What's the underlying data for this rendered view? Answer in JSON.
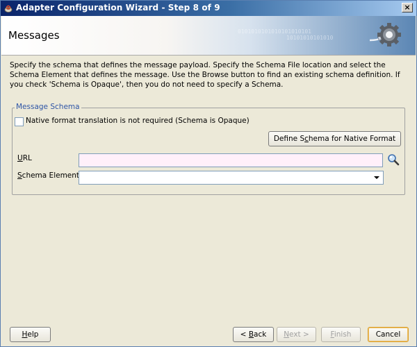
{
  "window": {
    "title": "Adapter Configuration Wizard - Step 8 of 9",
    "close_label": "×"
  },
  "header": {
    "title": "Messages",
    "digits_line1": "0101010101010101010101",
    "digits_line2": "10101010101010",
    "icon": "gear-plug-icon"
  },
  "description": "Specify the schema that defines the message payload.  Specify the Schema File location and select the Schema Element that defines the message. Use the Browse button to find an existing schema definition. If you check 'Schema is Opaque', then you do not need to specify a Schema.",
  "message_schema": {
    "legend": "Message Schema",
    "opaque_checkbox": {
      "label": "Native format translation is not required (Schema is Opaque)",
      "checked": false
    },
    "define_button": {
      "pre": "Define S",
      "mnemonic": "c",
      "post": "hema for Native Format"
    },
    "url": {
      "label_mnemonic": "U",
      "label_rest": "RL",
      "value": ""
    },
    "schema_element": {
      "label_mnemonic": "S",
      "label_rest": "chema Element",
      "value": ""
    }
  },
  "footer": {
    "help": {
      "mnemonic": "H",
      "rest": "elp"
    },
    "back": {
      "pre": "< ",
      "mnemonic": "B",
      "rest": "ack"
    },
    "next": {
      "mnemonic": "N",
      "rest": "ext >",
      "enabled": false
    },
    "finish": {
      "mnemonic": "F",
      "rest": "inish",
      "enabled": false
    },
    "cancel": {
      "label": "Cancel"
    }
  },
  "colors": {
    "title_bar": "#0a246a",
    "legend_text": "#2e55a6",
    "dialog_bg": "#ece9d8",
    "url_field_bg": "#fff0fa"
  }
}
